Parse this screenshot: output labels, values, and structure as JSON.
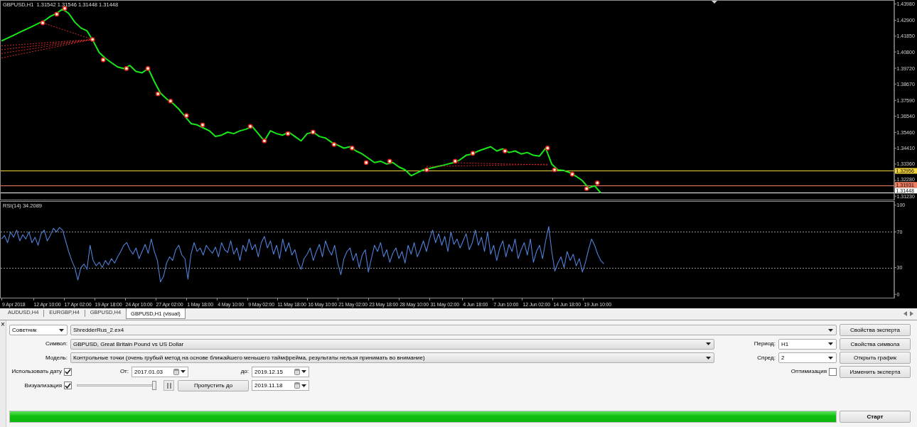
{
  "price_chart": {
    "header": "GBPUSD,H1  1.31542 1.31546 1.31448 1.31448",
    "chart_data": {
      "type": "line",
      "categories": [
        null,
        null,
        null,
        null,
        null,
        null,
        null,
        null,
        null,
        null,
        null,
        null,
        null,
        null,
        null,
        null,
        null,
        null,
        null,
        null,
        null,
        null,
        null,
        null,
        null,
        null,
        null,
        null,
        null,
        null,
        null,
        null,
        null,
        null,
        null,
        null,
        null,
        null,
        null,
        null,
        null,
        null,
        null,
        null,
        null,
        null,
        null,
        null,
        null,
        null,
        null,
        null,
        null,
        null,
        null,
        null,
        null,
        null,
        null,
        null,
        null,
        null,
        null,
        null,
        null,
        null,
        null,
        null,
        null,
        null,
        null,
        null,
        null,
        null,
        null,
        null,
        null,
        null,
        null,
        null,
        null,
        null,
        null,
        null,
        null,
        null,
        null,
        null,
        null,
        null,
        null,
        null,
        null,
        null,
        null,
        null,
        null,
        null,
        null,
        null,
        null,
        null,
        null,
        null,
        null,
        null,
        null,
        null,
        null,
        null,
        null,
        null,
        null,
        null,
        null,
        null,
        null,
        null,
        null,
        null,
        null,
        null,
        null,
        null,
        null,
        null,
        null,
        null,
        null,
        null,
        null,
        null,
        null,
        null,
        null,
        null,
        null,
        null,
        null,
        null,
        null,
        null,
        null,
        null,
        null,
        null,
        null
      ],
      "series": [
        {
          "color": "#19e619",
          "values": [
            1.4153,
            1.4172,
            1.4191,
            1.4211,
            1.423,
            1.4249,
            1.4268,
            1.4287,
            1.4316,
            1.4336,
            1.4364,
            1.4336,
            1.4278,
            1.4239,
            1.422,
            1.4153,
            1.4076,
            1.4038,
            1.4009,
            1.398,
            1.397,
            1.399,
            1.3951,
            1.3942,
            1.397,
            1.3884,
            1.3807,
            1.3769,
            1.374,
            1.3701,
            1.3653,
            1.3605,
            1.3596,
            1.3576,
            1.3557,
            1.3519,
            1.3528,
            1.3548,
            1.3538,
            1.3557,
            1.3567,
            1.3586,
            1.3538,
            1.349,
            1.3557,
            1.3538,
            1.3528,
            1.3548,
            1.3519,
            1.349,
            1.3538,
            1.3548,
            1.3519,
            1.3509,
            1.348,
            1.3461,
            1.3442,
            1.3451,
            1.3423,
            1.3403,
            1.3375,
            1.3346,
            1.3355,
            1.3336,
            1.3346,
            1.3317,
            1.3298,
            1.3259,
            1.3278,
            1.3298,
            1.3307,
            1.3317,
            1.3326,
            1.3336,
            1.3346,
            1.3365,
            1.3394,
            1.3403,
            1.3423,
            1.3437,
            1.3451,
            1.3423,
            1.3437,
            1.3413,
            1.3423,
            1.3403,
            1.3413,
            1.3394,
            1.3389,
            1.3442,
            1.3336,
            1.3298,
            1.3293,
            1.3278,
            1.3254,
            1.3226,
            1.3178,
            1.3192,
            1.3145,
            null,
            null,
            null,
            null,
            null,
            null,
            null,
            null,
            null,
            null,
            null,
            null,
            null,
            null,
            null,
            null,
            null,
            null,
            null,
            null,
            null,
            null,
            null,
            null,
            null,
            null,
            null,
            null,
            null,
            null,
            null,
            null,
            null,
            null,
            null,
            null,
            null,
            null,
            null,
            null,
            null,
            null,
            null,
            null,
            null,
            null,
            null,
            null
          ]
        }
      ],
      "ylim": [
        1.31,
        1.442
      ],
      "yticks": [
        {
          "value": 1.4398,
          "label": "1.43980"
        },
        {
          "value": 1.429,
          "label": "1.42900"
        },
        {
          "value": 1.4185,
          "label": "1.41850"
        },
        {
          "value": 1.408,
          "label": "1.40800"
        },
        {
          "value": 1.3972,
          "label": "1.39720"
        },
        {
          "value": 1.3867,
          "label": "1.38670"
        },
        {
          "value": 1.3759,
          "label": "1.37590"
        },
        {
          "value": 1.3654,
          "label": "1.36540"
        },
        {
          "value": 1.3546,
          "label": "1.35460"
        },
        {
          "value": 1.3441,
          "label": "1.34410"
        },
        {
          "value": 1.3336,
          "label": "1.33360"
        },
        {
          "value": 1.3228,
          "label": "1.32280"
        },
        {
          "value": 1.3123,
          "label": "1.31230"
        }
      ],
      "ref_lines": [
        {
          "axis": "y",
          "value": 1.32956,
          "label": "1.32956",
          "color": "#f2d33c"
        },
        {
          "axis": "y",
          "value": 1.31931,
          "label": "1.31931",
          "color": "#f07f62"
        },
        {
          "axis": "y",
          "value": 1.31448,
          "label": "1.31448",
          "color": "#ffffff"
        }
      ]
    }
  },
  "rsi_chart": {
    "header": "RSI(14) 34.2089",
    "chart_data": {
      "type": "line",
      "categories": [
        null,
        null,
        null,
        null,
        "9 Apr 2018",
        null,
        null,
        null,
        null,
        null,
        null,
        null,
        null,
        null,
        null,
        "12 Apr 10:00",
        null,
        null,
        null,
        null,
        null,
        null,
        null,
        null,
        null,
        "17 Apr 02:00",
        null,
        null,
        null,
        null,
        null,
        null,
        null,
        null,
        null,
        "19 Apr 18:00",
        null,
        null,
        null,
        null,
        null,
        null,
        null,
        null,
        null,
        "24 Apr 10:00",
        null,
        null,
        null,
        null,
        null,
        null,
        null,
        null,
        null,
        "27 Apr 02:00",
        null,
        null,
        null,
        null,
        null,
        null,
        null,
        null,
        null,
        "1 May 18:00",
        null,
        null,
        null,
        null,
        null,
        null,
        null,
        null,
        null,
        "4 May 10:00",
        null,
        null,
        null,
        null,
        null,
        null,
        null,
        null,
        null,
        "9 May 02:00",
        null,
        null,
        null,
        null,
        null,
        null,
        null,
        null,
        null,
        "11 May 18:00",
        null,
        null,
        null,
        null,
        null,
        null,
        null,
        null,
        null,
        "16 May 10:00",
        null,
        null,
        null,
        null,
        null,
        null,
        null,
        null,
        null,
        "21 May 02:00",
        null,
        null,
        null,
        null,
        null,
        null,
        null,
        null,
        null,
        "23 May 18:00",
        null,
        null,
        null,
        null,
        null,
        null,
        null,
        null,
        null,
        "28 May 10:00",
        null,
        null,
        null,
        null,
        null,
        null,
        null,
        null,
        null,
        "31 May 02:00",
        null,
        null,
        null,
        null,
        null,
        null,
        null,
        null,
        null,
        "4 Jun 18:00",
        null,
        null,
        null,
        null,
        null,
        null,
        null,
        null,
        null,
        "7 Jun 10:00",
        null,
        null,
        null,
        null,
        null,
        null,
        null,
        null,
        null,
        "12 Jun 02:00",
        null,
        null,
        null,
        null,
        null,
        null,
        null,
        null,
        null,
        "14 Jun 18:00",
        null,
        null,
        null,
        null,
        null,
        null,
        null,
        null,
        null,
        "19 Jun 10:00",
        null,
        null,
        null,
        null,
        null,
        null,
        null,
        null,
        null,
        null,
        null,
        null,
        null,
        null,
        null,
        null,
        null,
        null,
        null,
        null,
        null,
        null,
        null,
        null,
        null,
        null,
        null,
        null,
        null,
        null,
        null,
        null,
        null,
        null,
        null,
        null,
        null,
        null,
        null,
        null,
        null,
        null,
        null,
        null,
        null,
        null,
        null,
        null,
        null,
        null,
        null,
        null,
        null,
        null,
        null,
        null,
        null,
        null,
        null,
        null,
        null,
        null,
        null,
        null,
        null,
        null,
        null,
        null,
        null,
        null,
        null,
        null,
        null,
        null,
        null,
        null,
        null,
        null,
        null,
        null,
        null,
        null,
        null,
        null,
        null,
        null,
        null,
        null,
        null,
        null,
        null,
        null,
        null,
        null,
        null,
        null,
        null
      ],
      "series": [
        {
          "color": "#4f80d8",
          "values": [
            62,
            66,
            58,
            70,
            64,
            72,
            60,
            67,
            62,
            70,
            58,
            64,
            55,
            68,
            72,
            60,
            66,
            74,
            70,
            75,
            72,
            60,
            48,
            38,
            30,
            16,
            30,
            34,
            28,
            55,
            38,
            32,
            36,
            30,
            38,
            33,
            40,
            35,
            42,
            48,
            55,
            58,
            50,
            45,
            52,
            40,
            48,
            56,
            46,
            62,
            48,
            38,
            14,
            20,
            35,
            42,
            38,
            50,
            55,
            44,
            40,
            17,
            45,
            58,
            48,
            52,
            44,
            55,
            50,
            46,
            53,
            42,
            58,
            50,
            47,
            60,
            45,
            52,
            38,
            55,
            48,
            62,
            50,
            56,
            42,
            58,
            65,
            52,
            60,
            45,
            55,
            40,
            62,
            48,
            58,
            44,
            50,
            36,
            28,
            40,
            45,
            52,
            38,
            48,
            56,
            42,
            60,
            50,
            44,
            55,
            35,
            22,
            40,
            48,
            52,
            38,
            46,
            30,
            44,
            50,
            25,
            40,
            55,
            48,
            58,
            42,
            50,
            36,
            46,
            52,
            40,
            48,
            35,
            55,
            45,
            58,
            42,
            50,
            60,
            48,
            62,
            72,
            58,
            68,
            55,
            65,
            48,
            70,
            56,
            62,
            52,
            60,
            68,
            50,
            58,
            72,
            55,
            64,
            48,
            70,
            45,
            55,
            38,
            52,
            60,
            42,
            56,
            48,
            62,
            40,
            50,
            58,
            44,
            62,
            36,
            48,
            55,
            40,
            60,
            76,
            48,
            26,
            35,
            42,
            30,
            48,
            38,
            45,
            32,
            40,
            25,
            36,
            50,
            62,
            55,
            45,
            38,
            34.2,
            null,
            null,
            null,
            null,
            null,
            null,
            null,
            null,
            null,
            null,
            null,
            null,
            null,
            null,
            null,
            null,
            null,
            null,
            null,
            null,
            null,
            null,
            null,
            null,
            null,
            null,
            null,
            null,
            null,
            null,
            null,
            null,
            null,
            null,
            null,
            null,
            null,
            null,
            null,
            null,
            null,
            null,
            null,
            null,
            null,
            null,
            null,
            null,
            null,
            null,
            null,
            null,
            null,
            null,
            null,
            null,
            null,
            null,
            null,
            null,
            null,
            null,
            null,
            null,
            null,
            null,
            null,
            null,
            null,
            null,
            null,
            null,
            null,
            null,
            null,
            null,
            null,
            null,
            null,
            null,
            null,
            null,
            null,
            null,
            null,
            null,
            null,
            null,
            null,
            null,
            null,
            null,
            null,
            null,
            null
          ]
        }
      ],
      "ylim": [
        -3,
        103
      ],
      "yticks": [
        100,
        70,
        30,
        0
      ],
      "ref_lines": [
        {
          "axis": "y",
          "value": 70
        },
        {
          "axis": "y",
          "value": 30
        }
      ]
    }
  },
  "tabs": [
    {
      "label": "AUDUSD,H4",
      "selected": false
    },
    {
      "label": "EURGBP,H4",
      "selected": false
    },
    {
      "label": "GBPUSD,H4",
      "selected": false
    },
    {
      "label": "GBPUSD,H1 (visual)",
      "selected": true
    }
  ],
  "tester": {
    "close": "×",
    "expert_type": "Советник",
    "expert": "ShredderRus_2.ex4",
    "expert_properties_button": "Свойства эксперта",
    "symbol": {
      "label": "Символ:",
      "value": "GBPUSD, Great Britain Pound vs US Dollar"
    },
    "period": {
      "label": "Период:",
      "value": "H1"
    },
    "symbol_properties_button": "Свойства символа",
    "model": {
      "label": "Модель:",
      "value": "Контрольные точки (очень грубый метод на основе ближайшего меньшего таймфрейма, результаты нельзя принимать во внимание)"
    },
    "spread": {
      "label": "Спред:",
      "value": "2"
    },
    "open_chart_button": "Открыть график",
    "use_date": {
      "label": "Использовать дату",
      "checked": true
    },
    "from": {
      "label": "От:",
      "value": "2017.01.03"
    },
    "to": {
      "label": "до:",
      "value": "2019.12.15"
    },
    "optimization": {
      "label": "Оптимизация",
      "checked": false
    },
    "modify_expert_button": "Изменить эксперта",
    "visualization": {
      "label": "Визуализация",
      "checked": true
    },
    "speed": {
      "level": 1
    },
    "skip_button": "Пропустить до",
    "skip_date": "2019.11.18",
    "progress": {
      "level": 1
    },
    "start_button": "Старт"
  }
}
